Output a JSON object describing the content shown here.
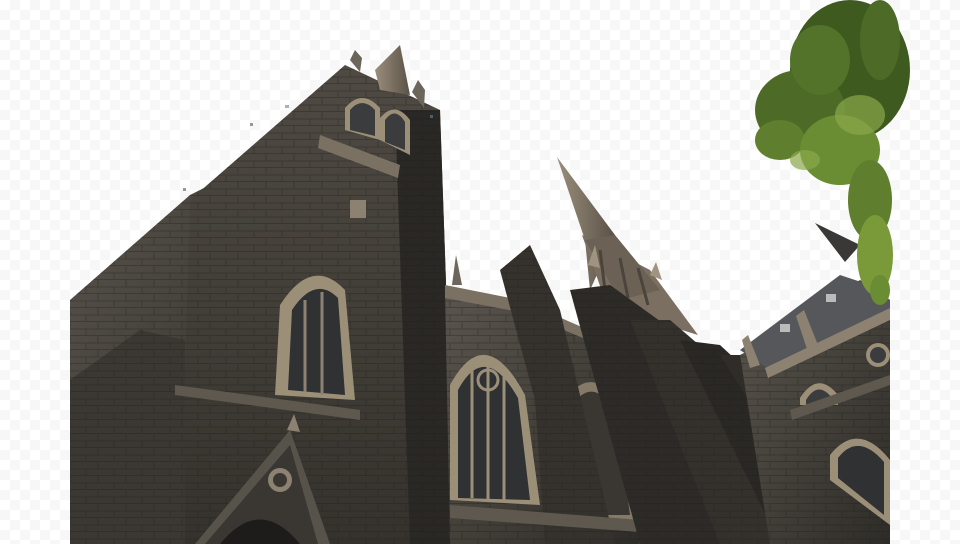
{
  "image": {
    "subject": "gothic-cathedral",
    "colors": {
      "background": "#ffffff",
      "stone_dark": "#2e2c28",
      "stone_mid": "#4a4640",
      "stone_light": "#6b655b",
      "window_glass": "#3a3c3e",
      "window_frame": "#9c8f78",
      "roof_slate": "#55575a",
      "spire_light": "#8d8272",
      "foliage_dark": "#3f5a1f",
      "foliage_light": "#7a9a3a"
    }
  }
}
